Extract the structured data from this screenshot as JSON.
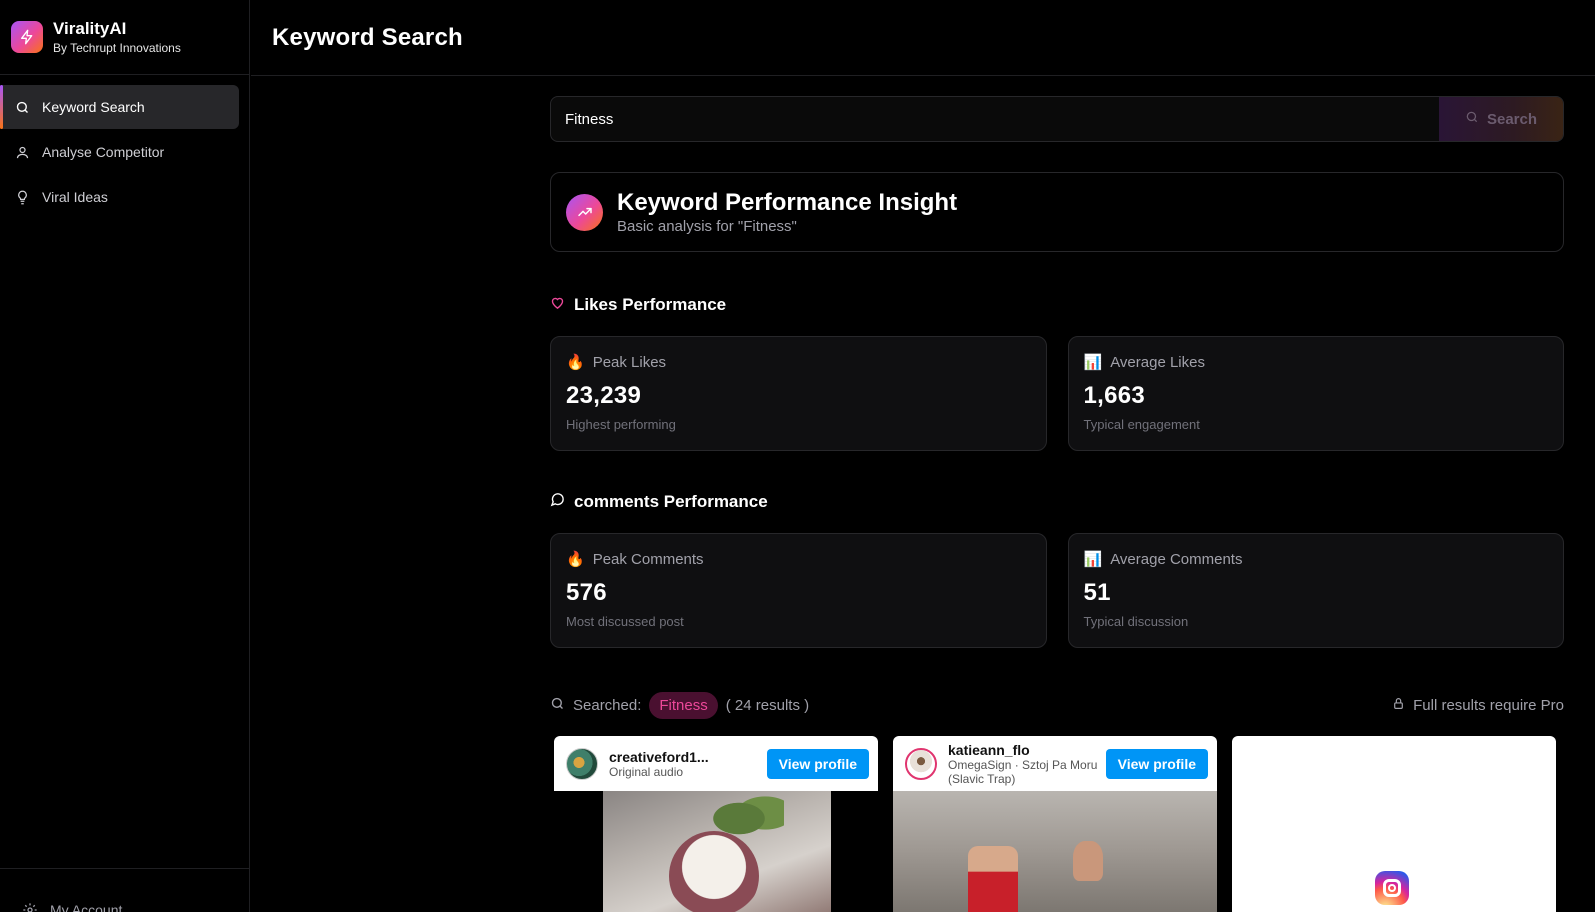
{
  "brand": {
    "name": "ViralityAI",
    "subtitle": "By Techrupt Innovations"
  },
  "sidebar": {
    "items": [
      {
        "label": "Keyword Search",
        "icon": "search-icon",
        "active": true
      },
      {
        "label": "Analyse Competitor",
        "icon": "user-icon",
        "active": false
      },
      {
        "label": "Viral Ideas",
        "icon": "lightbulb-icon",
        "active": false
      }
    ],
    "footer": {
      "label": "My Account",
      "icon": "gear-icon"
    }
  },
  "header": {
    "title": "Keyword Search"
  },
  "search": {
    "value": "Fitness",
    "button_label": "Search"
  },
  "insight": {
    "title": "Keyword Performance Insight",
    "subtitle": "Basic analysis for \"Fitness\""
  },
  "likes": {
    "title": "Likes Performance",
    "peak": {
      "label": "Peak Likes",
      "value": "23,239",
      "note": "Highest performing",
      "icon": "fire-icon"
    },
    "average": {
      "label": "Average Likes",
      "value": "1,663",
      "note": "Typical engagement",
      "icon": "bar-chart-icon"
    }
  },
  "comments": {
    "title": "comments Performance",
    "peak": {
      "label": "Peak Comments",
      "value": "576",
      "note": "Most discussed post",
      "icon": "fire-icon"
    },
    "average": {
      "label": "Average Comments",
      "value": "51",
      "note": "Typical discussion",
      "icon": "bar-chart-icon"
    }
  },
  "results": {
    "searched_label": "Searched:",
    "keyword": "Fitness",
    "count": "( 24 results )",
    "pro_note": "Full results require Pro"
  },
  "posts": [
    {
      "username": "creativeford1...",
      "audio": "Original audio",
      "button": "View profile"
    },
    {
      "username": "katieann_flo",
      "audio": "OmegaSign · Sztoj Pa Moru (Slavic Trap)",
      "button": "View profile"
    }
  ],
  "colors": {
    "accent_pink": "#ec4899",
    "accent_purple": "#a855f7",
    "accent_orange": "#f97316",
    "instagram_blue": "#0095f6"
  }
}
